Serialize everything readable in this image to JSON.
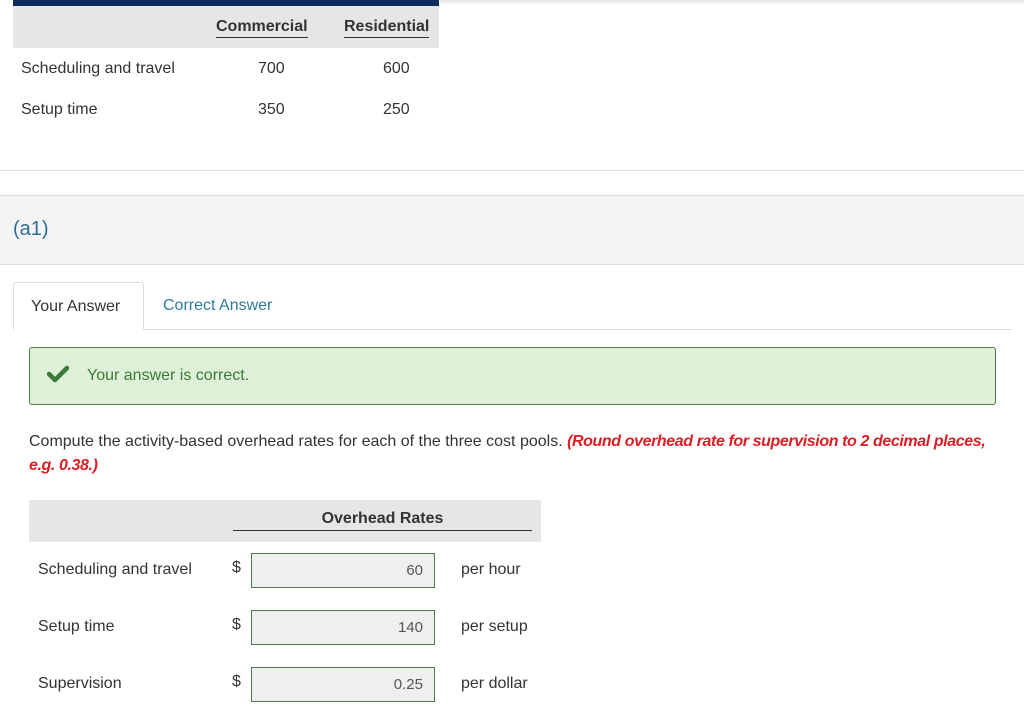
{
  "data_table": {
    "columns": [
      "Commercial",
      "Residential"
    ],
    "rows": [
      {
        "label": "Scheduling and travel",
        "values": [
          "700",
          "600"
        ]
      },
      {
        "label": "Setup time",
        "values": [
          "350",
          "250"
        ]
      }
    ]
  },
  "part": {
    "label": "(a1)"
  },
  "tabs": [
    {
      "label": "Your Answer",
      "active": true
    },
    {
      "label": "Correct Answer",
      "active": false
    }
  ],
  "alert": {
    "icon": "checkmark-icon",
    "text": "Your answer is correct.",
    "color": "#3d7a3a",
    "bg": "#def0d8"
  },
  "question": {
    "text": "Compute the activity-based overhead rates for each of the three cost pools.",
    "note": "(Round overhead rate for supervision to 2 decimal places, e.g. 0.38.)",
    "note_color": "#dd1e25"
  },
  "rates": {
    "header": "Overhead Rates",
    "currency": "$",
    "rows": [
      {
        "label": "Scheduling and travel",
        "value": "60",
        "unit": "per hour"
      },
      {
        "label": "Setup time",
        "value": "140",
        "unit": "per setup"
      },
      {
        "label": "Supervision",
        "value": "0.25",
        "unit": "per dollar"
      }
    ]
  }
}
